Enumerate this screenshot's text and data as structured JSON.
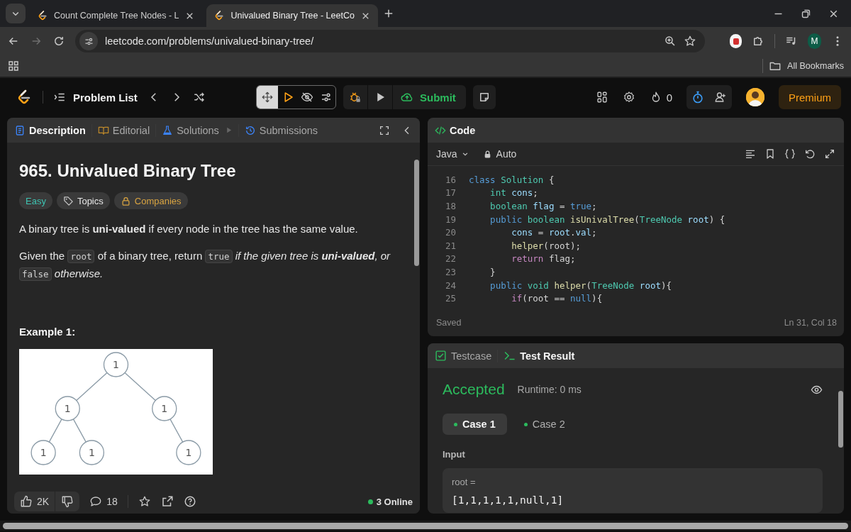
{
  "browser": {
    "tabs": [
      {
        "title": "Count Complete Tree Nodes - L",
        "selected": false
      },
      {
        "title": "Univalued Binary Tree - LeetCo",
        "selected": true
      }
    ],
    "forward_disabled": true,
    "url": "leetcode.com/problems/univalued-binary-tree/",
    "profile_initial": "M",
    "bookmarks_label": "All Bookmarks"
  },
  "toolbar": {
    "problem_list": "Problem List",
    "submit": "Submit",
    "streak": "0",
    "premium": "Premium"
  },
  "description_panel": {
    "tabs": [
      {
        "label": "Description",
        "selected": true
      },
      {
        "label": "Editorial",
        "selected": false
      },
      {
        "label": "Solutions",
        "selected": false
      },
      {
        "label": "Submissions",
        "selected": false
      }
    ],
    "title": "965. Univalued Binary Tree",
    "tags": [
      {
        "label": "Easy",
        "kind": "difficulty"
      },
      {
        "label": "Topics",
        "kind": "topics"
      },
      {
        "label": "Companies",
        "kind": "companies"
      }
    ],
    "paragraphs": [
      [
        {
          "kind": "text",
          "t": "A binary tree is **uni-valued** if every node in the tree has the same value."
        }
      ],
      [
        {
          "kind": "text",
          "t": "Given the "
        },
        {
          "kind": "code",
          "t": "root"
        },
        {
          "kind": "text",
          "t": " of a binary tree, return "
        },
        {
          "kind": "code",
          "t": "true"
        },
        {
          "kind": "em",
          "t": " if the given tree is **uni-valued**, or "
        },
        {
          "kind": "code",
          "t": "false"
        },
        {
          "kind": "em",
          "t": " otherwise."
        }
      ]
    ],
    "example_heading": "Example 1:",
    "example_tree": {
      "value": "1",
      "left": {
        "value": "1",
        "left": {
          "value": "1"
        },
        "right": {
          "value": "1"
        }
      },
      "right": {
        "value": "1",
        "right": {
          "value": "1"
        }
      }
    },
    "footer": {
      "likes": "2K",
      "comments": "18",
      "online": "3 Online"
    }
  },
  "code_panel": {
    "title": "Code",
    "language": "Java",
    "mode": "Auto",
    "lines": [
      {
        "n": "16",
        "tokens": [
          {
            "t": "class ",
            "kind": "kw"
          },
          {
            "t": "Solution",
            "kind": "type"
          },
          {
            "t": " {",
            "kind": "p"
          }
        ]
      },
      {
        "n": "17",
        "tokens": [
          {
            "t": "    int ",
            "kind": "type"
          },
          {
            "t": "cons",
            "kind": "var"
          },
          {
            "t": ";",
            "kind": "p"
          }
        ]
      },
      {
        "n": "18",
        "tokens": [
          {
            "t": "    boolean ",
            "kind": "type"
          },
          {
            "t": "flag",
            "kind": "var"
          },
          {
            "t": " = ",
            "kind": "p"
          },
          {
            "t": "true",
            "kind": "kw"
          },
          {
            "t": ";",
            "kind": "p"
          }
        ]
      },
      {
        "n": "19",
        "tokens": [
          {
            "t": "    public ",
            "kind": "kw"
          },
          {
            "t": "boolean ",
            "kind": "type"
          },
          {
            "t": "isUnivalTree",
            "kind": "fn"
          },
          {
            "t": "(",
            "kind": "p"
          },
          {
            "t": "TreeNode ",
            "kind": "type"
          },
          {
            "t": "root",
            "kind": "var"
          },
          {
            "t": ") {",
            "kind": "p"
          }
        ]
      },
      {
        "n": "20",
        "tokens": [
          {
            "t": "        cons",
            "kind": "var"
          },
          {
            "t": " = ",
            "kind": "p"
          },
          {
            "t": "root",
            "kind": "var"
          },
          {
            "t": ".",
            "kind": "p"
          },
          {
            "t": "val",
            "kind": "var"
          },
          {
            "t": ";",
            "kind": "p"
          }
        ]
      },
      {
        "n": "21",
        "tokens": [
          {
            "t": "        helper",
            "kind": "fn"
          },
          {
            "t": "(root);",
            "kind": "p"
          }
        ]
      },
      {
        "n": "22",
        "tokens": [
          {
            "t": "        return",
            "kind": "ctrl"
          },
          {
            "t": " flag;",
            "kind": "p"
          }
        ]
      },
      {
        "n": "23",
        "tokens": [
          {
            "t": "    }",
            "kind": "p"
          }
        ]
      },
      {
        "n": "24",
        "tokens": [
          {
            "t": "    public ",
            "kind": "kw"
          },
          {
            "t": "void ",
            "kind": "type"
          },
          {
            "t": "helper",
            "kind": "fn"
          },
          {
            "t": "(",
            "kind": "p"
          },
          {
            "t": "TreeNode ",
            "kind": "type"
          },
          {
            "t": "root",
            "kind": "var"
          },
          {
            "t": "){",
            "kind": "p"
          }
        ]
      },
      {
        "n": "25",
        "tokens": [
          {
            "t": "        if",
            "kind": "ctrl"
          },
          {
            "t": "(root == ",
            "kind": "p"
          },
          {
            "t": "null",
            "kind": "kw"
          },
          {
            "t": "){",
            "kind": "p"
          }
        ]
      }
    ],
    "status": "Saved",
    "cursor": "Ln 31, Col 18"
  },
  "test_panel": {
    "tabs": [
      {
        "label": "Testcase",
        "selected": false
      },
      {
        "label": "Test Result",
        "selected": true
      }
    ],
    "verdict": "Accepted",
    "runtime": "Runtime: 0 ms",
    "cases": [
      {
        "label": "Case 1",
        "selected": true,
        "passed": true
      },
      {
        "label": "Case 2",
        "selected": false,
        "passed": true
      }
    ],
    "input_label": "Input",
    "input_name": "root =",
    "input_value": "[1,1,1,1,1,null,1]"
  }
}
